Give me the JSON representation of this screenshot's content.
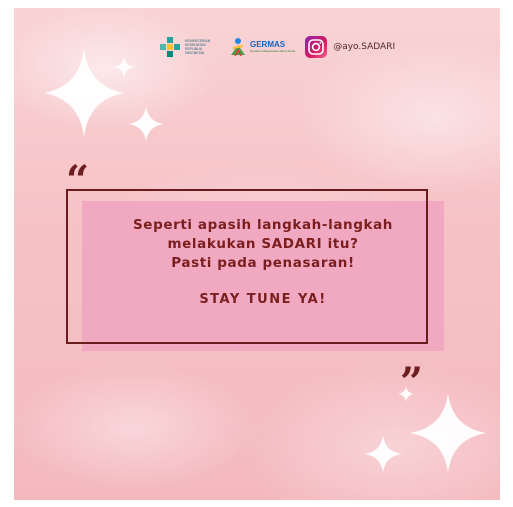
{
  "header": {
    "ministry_logo_text": [
      "KEMENTERIAN",
      "KESEHATAN",
      "REPUBLIK",
      "INDONESIA"
    ],
    "germas_logo_text": "GERMAS",
    "germas_tagline": "Gerakan Masyarakat Hidup Sehat",
    "instagram_handle": "@ayo.SADARI"
  },
  "quote": {
    "open_mark": "“",
    "close_mark": "”",
    "lines": [
      "Seperti apasih langkah-langkah",
      "melakukan SADARI itu?",
      "Pasti pada penasaran!"
    ],
    "call_to_action": "STAY TUNE YA!"
  },
  "colors": {
    "background": "#f6c2c6",
    "text": "#7a1e1e",
    "frame": "#6b1c1c",
    "shadow_box": "#f1a9c2"
  },
  "icons": [
    "kemenkes-logo",
    "germas-logo",
    "instagram-icon",
    "sparkle-icon"
  ]
}
